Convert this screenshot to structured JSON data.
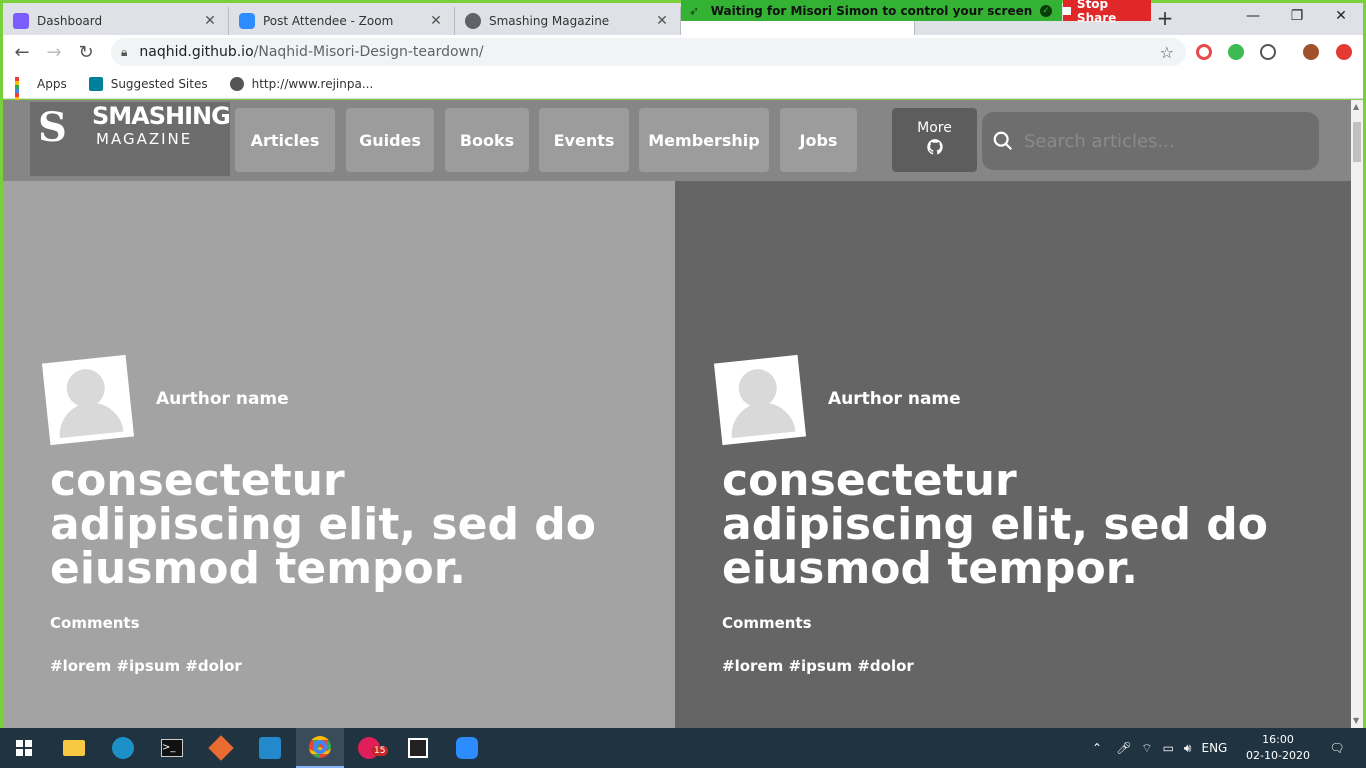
{
  "tabs": [
    {
      "title": "Dashboard",
      "favicon_color": "#7b5cff"
    },
    {
      "title": "Post Attendee - Zoom",
      "favicon_color": "#2d8cff"
    },
    {
      "title": "Smashing Magazine",
      "favicon_color": "#5f6368"
    }
  ],
  "share_banner": {
    "text": "Waiting for Misori Simon to control your screen",
    "stop_label": "Stop Share"
  },
  "window_controls": {
    "minimize": "—",
    "maximize": "❐",
    "close": "✕"
  },
  "address_bar": {
    "host": "naqhid.github.io",
    "path": "/Naqhid-Misori-Design-teardown/"
  },
  "bookmarks": [
    {
      "label": "Apps",
      "icon": "apps-grid-icon"
    },
    {
      "label": "Suggested Sites",
      "icon": "bing-icon"
    },
    {
      "label": "http://www.rejinpa...",
      "icon": "globe-icon"
    }
  ],
  "site": {
    "logo_primary": "SMASHING",
    "logo_secondary": "MAGAZINE",
    "logo_mark": "S",
    "nav": [
      "Articles",
      "Guides",
      "Books",
      "Events",
      "Membership",
      "Jobs"
    ],
    "more_label": "More",
    "search_placeholder": "Search articles..."
  },
  "cards": [
    {
      "author": "Aurthor name",
      "headline": "consectetur adipiscing elit, sed do eiusmod tempor.",
      "comments": "Comments",
      "tags": "#lorem #ipsum #dolor"
    },
    {
      "author": "Aurthor name",
      "headline": "consectetur adipiscing elit, sed do eiusmod tempor.",
      "comments": "Comments",
      "tags": "#lorem #ipsum #dolor"
    }
  ],
  "taskbar": {
    "apps": [
      "start-icon",
      "file-explorer-icon",
      "edge-icon",
      "terminal-icon",
      "git-icon",
      "vscode-icon",
      "chrome-icon",
      "slack-icon",
      "window-icon",
      "zoom-icon"
    ],
    "slack_badge": "15",
    "language": "ENG",
    "time": "16:00",
    "date": "02-10-2020"
  },
  "colors": {
    "share_border": "#7ad03a",
    "header_bg": "#868686",
    "card_left_bg": "#a3a3a3",
    "card_right_bg": "#656565",
    "stop_share": "#e02828",
    "taskbar_bg": "#1f3340"
  }
}
